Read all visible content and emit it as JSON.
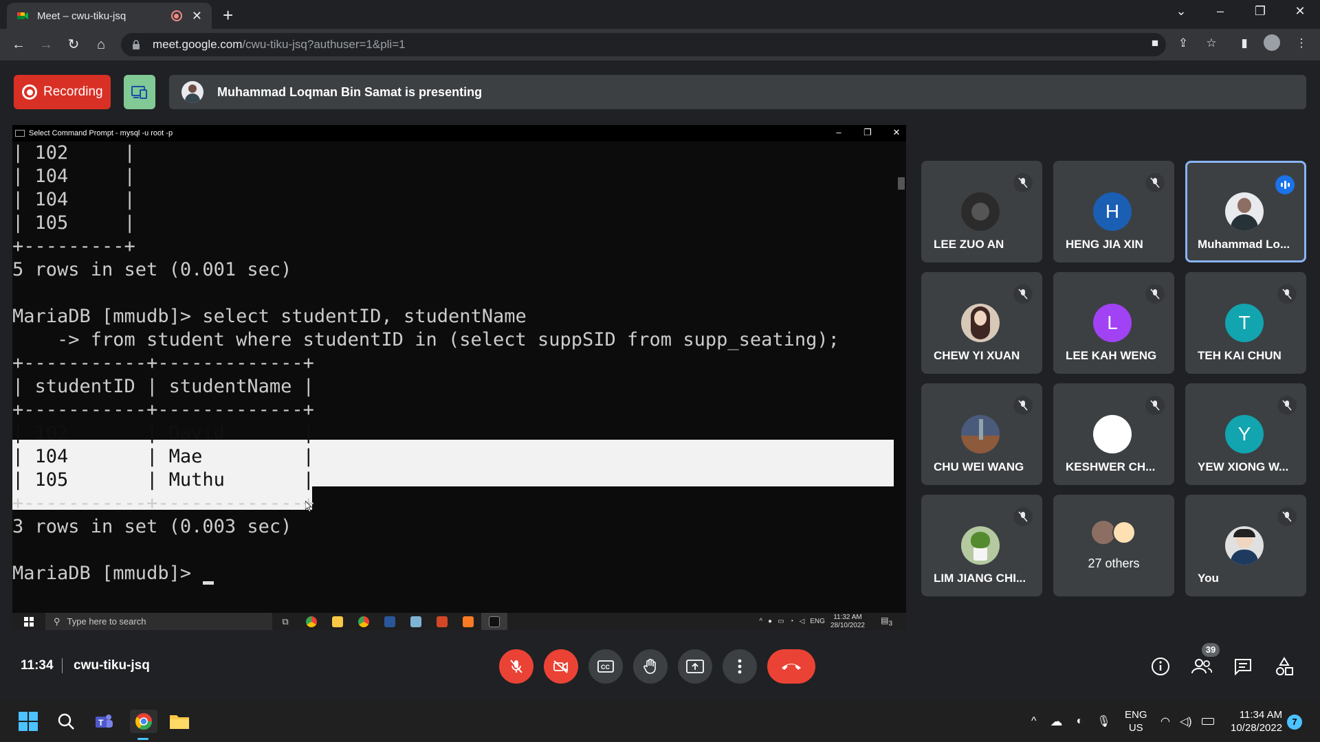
{
  "browser": {
    "tab_title": "Meet – cwu-tiku-jsq",
    "url_host": "meet.google.com",
    "url_path": "/cwu-tiku-jsq?authuser=1&pli=1"
  },
  "meet": {
    "recording_label": "Recording",
    "presenting_text": "Muhammad Loqman Bin Samat is presenting",
    "time": "11:34",
    "meeting_code": "cwu-tiku-jsq",
    "people_count": "39"
  },
  "cmd": {
    "window_title": "Select Command Prompt - mysql  -u root -p",
    "lines": [
      "| 102     |",
      "| 104     |",
      "| 104     |",
      "| 105     |",
      "+---------+",
      "5 rows in set (0.001 sec)",
      "",
      "MariaDB [mmudb]> select studentID, studentName",
      "    -> from student where studentID in (select suppSID from supp_seating);",
      "+-----------+-------------+",
      "| studentID | studentName |",
      "+-----------+-------------+",
      "| 102       | David       |",
      "| 104       | Mae         |",
      "| 105       | Muthu       |",
      "+-----------+-------------+",
      "3 rows in set (0.003 sec)",
      "",
      "MariaDB [mmudb]> "
    ],
    "taskbar_search": "Type here to search",
    "tray_lang": "ENG",
    "tray_time": "11:32 AM",
    "tray_date": "28/10/2022",
    "tray_notif": "3"
  },
  "participants": [
    {
      "name": "LEE ZUO AN",
      "initial": "",
      "color": "#2b2b2b",
      "state": "muted"
    },
    {
      "name": "HENG JIA XIN",
      "initial": "H",
      "color": "#1a5fb4",
      "state": "muted"
    },
    {
      "name": "Muhammad Lo...",
      "initial": "",
      "color": "#e8eaed",
      "state": "speaking"
    },
    {
      "name": "CHEW YI XUAN",
      "initial": "",
      "color": "#d8c8b8",
      "state": "muted"
    },
    {
      "name": "LEE KAH WENG",
      "initial": "L",
      "color": "#a142f4",
      "state": "muted"
    },
    {
      "name": "TEH KAI CHUN",
      "initial": "T",
      "color": "#12a4af",
      "state": "muted"
    },
    {
      "name": "CHU WEI WANG",
      "initial": "",
      "color": "#4a5a7a",
      "state": "muted"
    },
    {
      "name": "KESHWER CH...",
      "initial": "",
      "color": "#ffffff",
      "state": "muted"
    },
    {
      "name": "YEW XIONG W...",
      "initial": "Y",
      "color": "#12a4af",
      "state": "muted"
    },
    {
      "name": "LIM JIANG CHI...",
      "initial": "",
      "color": "#b5c9a0",
      "state": "muted"
    },
    {
      "name": "27 others",
      "initial": "",
      "color": "#8d6e63",
      "state": "others"
    },
    {
      "name": "You",
      "initial": "",
      "color": "#e0e0e0",
      "state": "muted"
    }
  ],
  "win11": {
    "lang_line1": "ENG",
    "lang_line2": "US",
    "time": "11:34 AM",
    "date": "10/28/2022",
    "notif": "7"
  },
  "colors": {
    "end_call": "#ea4335",
    "recording": "#d93025",
    "companion": "#81c995",
    "speaking_border": "#8ab4f8"
  }
}
